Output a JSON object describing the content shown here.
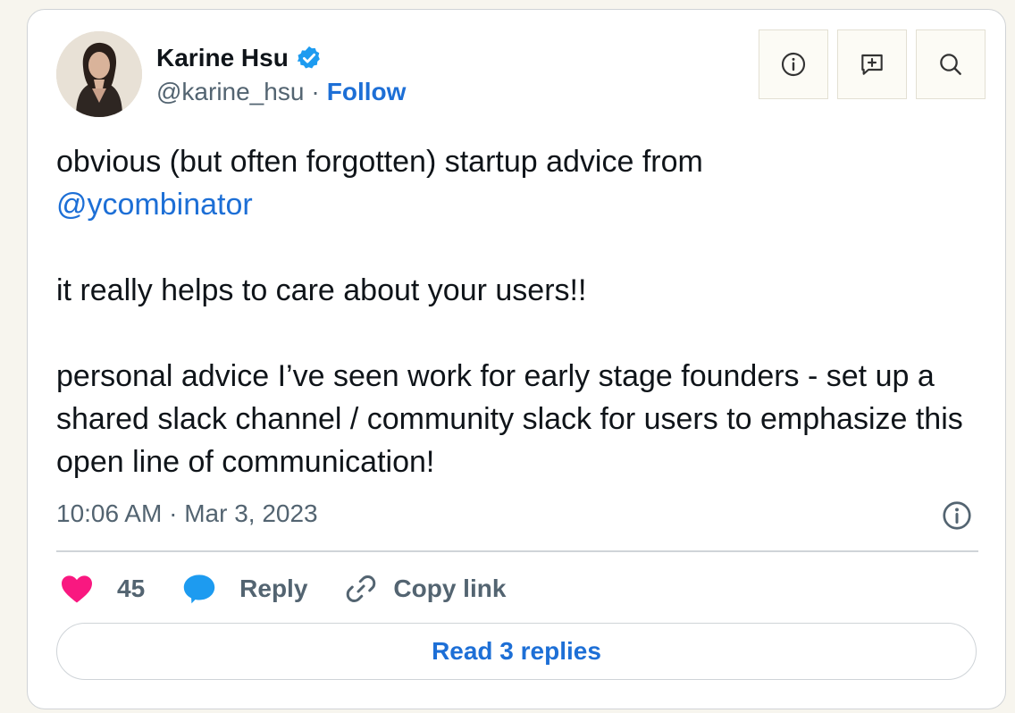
{
  "author": {
    "name": "Karine Hsu",
    "handle": "@karine_hsu",
    "separator": "·",
    "follow_label": "Follow",
    "verified": true
  },
  "toolbar": {
    "icons": [
      "info-icon",
      "add-comment-icon",
      "search-icon"
    ]
  },
  "tweet": {
    "line1_prefix": "obvious (but often forgotten) startup advice from",
    "mention": "@ycombinator",
    "paragraph2": "it really helps to care about your users!!",
    "paragraph3": "personal advice I’ve seen work for early stage founders - set up a shared slack channel / community slack for users to emphasize this open line of communication!"
  },
  "meta": {
    "time": "10:06 AM",
    "separator": "·",
    "date": "Mar 3, 2023"
  },
  "actions": {
    "like_count": "45",
    "reply_label": "Reply",
    "copy_link_label": "Copy link"
  },
  "read_replies_label": "Read 3 replies",
  "colors": {
    "accent": "#1d6fd6",
    "like": "#f91880",
    "reply": "#1d9bf0",
    "muted": "#536471",
    "page_bg": "#f7f5ee"
  }
}
